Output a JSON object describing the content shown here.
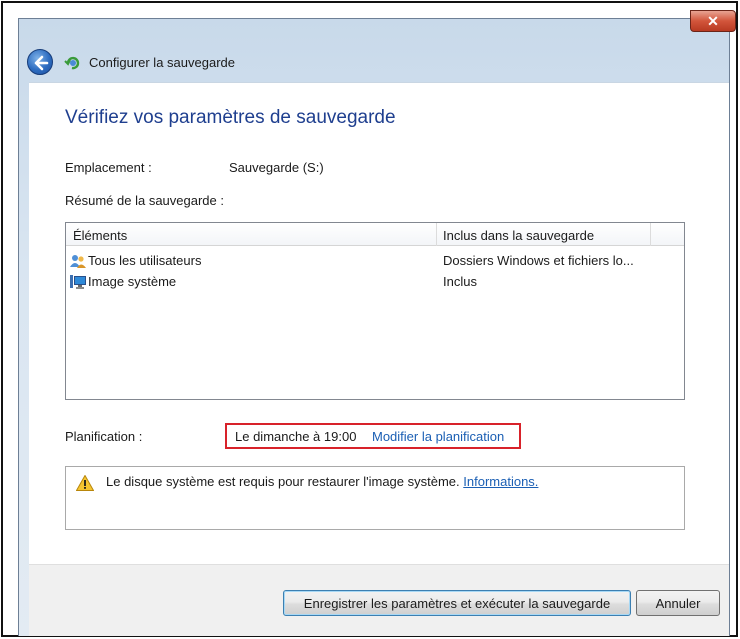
{
  "window": {
    "title": "Configurer la sauvegarde",
    "close_glyph": "✕"
  },
  "content": {
    "heading": "Vérifiez vos paramètres de sauvegarde",
    "location_label": "Emplacement :",
    "location_value": "Sauvegarde (S:)",
    "summary_label": "Résumé de la sauvegarde :"
  },
  "table": {
    "columns": [
      "Éléments",
      "Inclus dans la sauvegarde"
    ],
    "rows": [
      {
        "icon": "users-icon",
        "item": "Tous les utilisateurs",
        "included": "Dossiers Windows et fichiers lo..."
      },
      {
        "icon": "system-image-icon",
        "item": "Image système",
        "included": "Inclus"
      }
    ]
  },
  "schedule": {
    "label": "Planification :",
    "value": "Le dimanche à 19:00",
    "link": "Modifier la planification"
  },
  "info": {
    "icon": "warning-icon",
    "text": "Le disque système est requis pour restaurer l'image système.",
    "link": "Informations."
  },
  "buttons": {
    "save_run": "Enregistrer les paramètres et exécuter la sauvegarde",
    "cancel": "Annuler"
  },
  "colors": {
    "heading": "#1f3f8f",
    "link": "#1b5fb4",
    "highlight_border": "#d8222a"
  }
}
